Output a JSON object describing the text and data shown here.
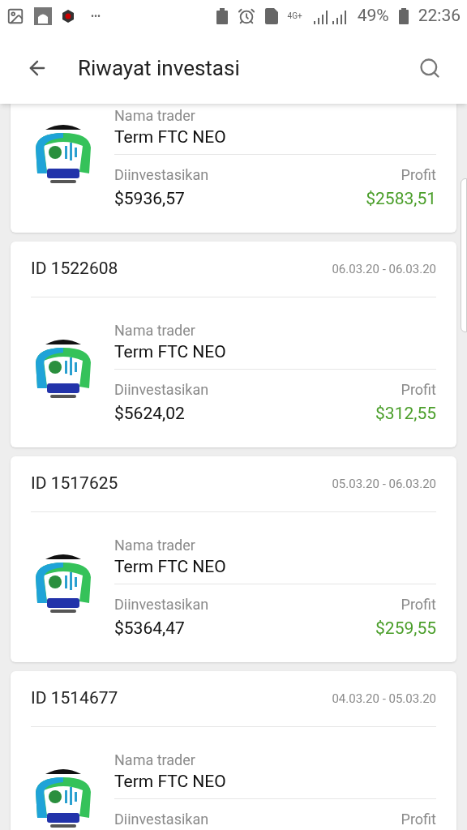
{
  "status_bar": {
    "more": "•••",
    "network": "4G+",
    "battery": "49%",
    "time": "22:36"
  },
  "app_bar": {
    "title": "Riwayat investasi"
  },
  "investments": [
    {
      "trader_label": "Nama trader",
      "trader": "Term FTC NEO",
      "invested_label": "Diinvestasikan",
      "invested": "$5936,57",
      "profit_label": "Profit",
      "profit": "$2583,51"
    },
    {
      "id": "ID 1522608",
      "dates": "06.03.20 - 06.03.20",
      "trader_label": "Nama trader",
      "trader": "Term FTC NEO",
      "invested_label": "Diinvestasikan",
      "invested": "$5624,02",
      "profit_label": "Profit",
      "profit": "$312,55"
    },
    {
      "id": "ID 1517625",
      "dates": "05.03.20 - 06.03.20",
      "trader_label": "Nama trader",
      "trader": "Term FTC NEO",
      "invested_label": "Diinvestasikan",
      "invested": "$5364,47",
      "profit_label": "Profit",
      "profit": "$259,55"
    },
    {
      "id": "ID 1514677",
      "dates": "04.03.20 - 05.03.20",
      "trader_label": "Nama trader",
      "trader": "Term FTC NEO",
      "invested_label": "Diinvestasikan",
      "profit_label": "Profit"
    }
  ]
}
